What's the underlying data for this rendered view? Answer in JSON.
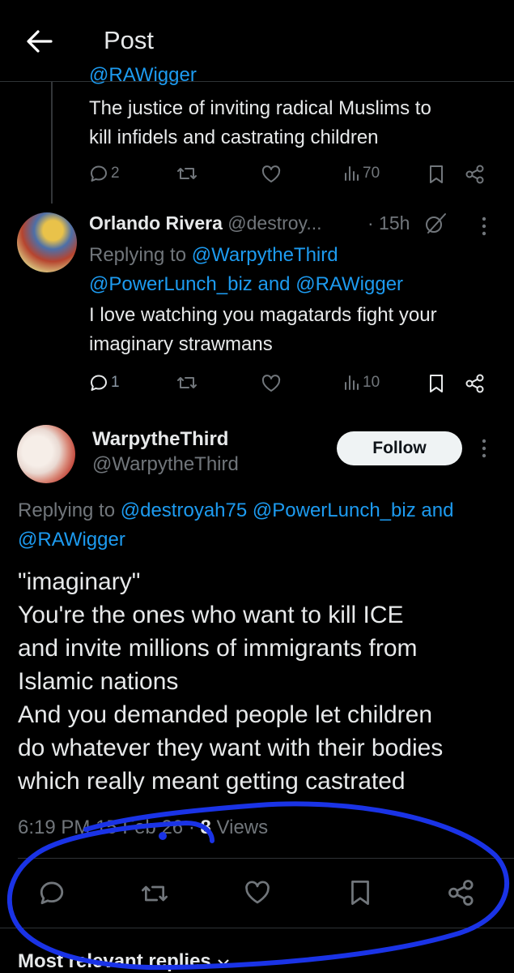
{
  "header": {
    "title": "Post"
  },
  "parent_reply": {
    "clipped_handle": "@RAWigger",
    "text_line1": "The justice of inviting radical Muslims to",
    "text_line2": "kill infidels and castrating children",
    "replies": "2",
    "views": "70"
  },
  "reply": {
    "name": "Orlando Rivera",
    "handle": "@destroy...",
    "time": "· 15h",
    "replying_prefix": "Replying to",
    "replying_user1": "@WarpytheThird",
    "replying_user2": "@PowerLunch_biz",
    "replying_and": "and",
    "replying_user3": "@RAWigger",
    "text_line1": "I love watching you magatards fight your",
    "text_line2": "imaginary strawmans",
    "replies": "1",
    "views": "10"
  },
  "main_post": {
    "name": "WarpytheThird",
    "handle": "@WarpytheThird",
    "follow_label": "Follow",
    "replying_prefix": "Replying to",
    "replying_user1": "@destroyah75",
    "replying_user2": "@PowerLunch_biz",
    "replying_and": "and",
    "replying_user3": "@RAWigger",
    "text_lines": [
      "\"imaginary\"",
      "You're the ones who want to kill ICE",
      "and invite millions of immigrants from",
      "Islamic nations",
      "And you demanded people let children",
      "do whatever they want with their bodies",
      "which really meant getting castrated"
    ],
    "time": "6:19 PM",
    "date": "15 Feb 26",
    "dot": "·",
    "views_count": "8",
    "views_label": "Views"
  },
  "replies_sort": {
    "label": "Most relevant replies"
  },
  "colors": {
    "accent": "#1d9bf0",
    "muted": "#71767b",
    "annotation": "#1a33e6"
  }
}
